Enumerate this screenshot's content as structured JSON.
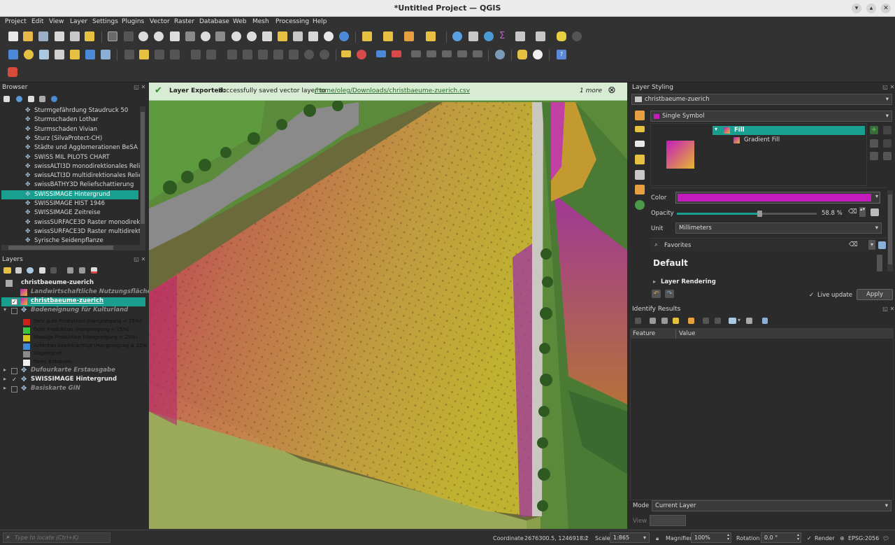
{
  "window": {
    "title": "*Untitled Project — QGIS",
    "minimize": "▾",
    "maximize": "▴",
    "close": "✕"
  },
  "menu": [
    "Project",
    "Edit",
    "View",
    "Layer",
    "Settings",
    "Plugins",
    "Vector",
    "Raster",
    "Database",
    "Web",
    "Mesh",
    "Processing",
    "Help"
  ],
  "browser": {
    "title": "Browser",
    "items": [
      "Sturmgefährdung Staudruck 50",
      "Sturmschaden Lothar",
      "Sturmschaden Vivian",
      "Sturz (SilvaProtect-CH)",
      "Städte und Agglomerationen BeSA",
      "SWISS MIL PILOTS CHART",
      "swissALTI3D monodirektionales Relie",
      "swissALTI3D multidirektionales Relie",
      "swissBATHY3D Reliefschattierung",
      "SWISSIMAGE Hintergrund",
      "SWISSIMAGE HIST 1946",
      "SWISSIMAGE Zeitreise",
      "swissSURFACE3D Raster monodirekti",
      "swissSURFACE3D Raster multidirektic",
      "Syrische Seidenpflanze"
    ],
    "selected_index": 9
  },
  "layers": {
    "title": "Layers",
    "group": "christbaeume-zuerich",
    "items": [
      {
        "label": "Landwirtschaftliche Nutzungsflächen  (1",
        "style": "italic-gray"
      },
      {
        "label": "christbaeume-zuerich",
        "style": "selected"
      },
      {
        "label": "Bodeneignung für Kulturland",
        "style": "italic-gray"
      },
      {
        "label": "Dufourkarte Erstausgabe",
        "style": "italic-gray"
      },
      {
        "label": "SWISSIMAGE Hintergrund",
        "style": "bold"
      },
      {
        "label": "Basiskarte GIN",
        "style": "italic-gray"
      }
    ],
    "legend": [
      {
        "label": "Sehr gute Produktion (Hangneigung < 25%)",
        "color": "#d0201c"
      },
      {
        "label": "Gute Produktion (Hangneigung < 25%)",
        "color": "#3cc43c"
      },
      {
        "label": "Massige Produktion (Hangneigung < 25%)",
        "color": "#d8c81c"
      },
      {
        "label": "Ackerbau beeinträchtigt (Hangneigung ≥ 25%",
        "color": "#3c8ad8"
      },
      {
        "label": "Ungeeignet",
        "color": "#8a8a8a"
      },
      {
        "label": "Seen, Enklaven",
        "color": "#f0f0f0"
      }
    ]
  },
  "message": {
    "title": "Layer Exported:",
    "text": "Successfully saved vector layer to",
    "link": "/home/oleg/Downloads/christbaeume-zuerich.csv",
    "more": "1 more",
    "close": "⊗"
  },
  "styling": {
    "title": "Layer Styling",
    "layer": "christbaeume-zuerich",
    "renderer": "Single Symbol",
    "tree": {
      "root": "Fill",
      "child": "Gradient Fill"
    },
    "color_label": "Color",
    "color": "#c41cbc",
    "opacity_label": "Opacity",
    "opacity_value": "58.8 %",
    "opacity_fraction": 0.588,
    "unit_label": "Unit",
    "unit_value": "Millimeters",
    "favorites": "Favorites",
    "default": "Default",
    "layer_rendering": "Layer Rendering",
    "live_update": "Live update",
    "apply": "Apply"
  },
  "identify": {
    "title": "Identify Results",
    "col_feature": "Feature",
    "col_value": "Value",
    "mode_label": "Mode",
    "mode_value": "Current Layer",
    "view_label": "View"
  },
  "status": {
    "locate_placeholder": "Type to locate (Ctrl+K)",
    "coordinate_label": "Coordinate",
    "coordinate_value": "2676300.5, 1246918.2",
    "scale_label": "Scale",
    "scale_value": "1:865",
    "magnifier_label": "Magnifier",
    "magnifier_value": "100%",
    "rotation_label": "Rotation",
    "rotation_value": "0.0 °",
    "render_label": "Render",
    "crs": "EPSG:2056"
  }
}
